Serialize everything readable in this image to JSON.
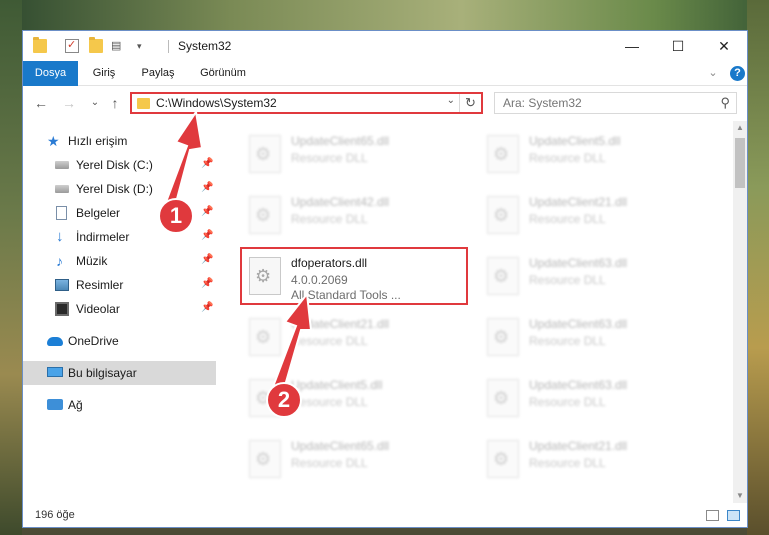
{
  "window": {
    "title": "System32",
    "minimize": "—",
    "maximize": "☐",
    "close": "✕"
  },
  "ribbon": {
    "tabs": [
      "Dosya",
      "Giriş",
      "Paylaş",
      "Görünüm"
    ],
    "active_tab": "Dosya",
    "expand": "⌄",
    "help": "?"
  },
  "nav": {
    "back": "←",
    "forward": "→",
    "recent": "⌄",
    "up": "↑",
    "address": "C:\\Windows\\System32",
    "address_dropdown": "⌄",
    "refresh": "↻",
    "search_placeholder": "Ara: System32"
  },
  "sidebar": {
    "items": [
      {
        "label": "Hızlı erişim",
        "icon": "star-icon",
        "pinned": false
      },
      {
        "label": "Yerel Disk (C:)",
        "icon": "drive-icon",
        "pinned": true
      },
      {
        "label": "Yerel Disk (D:)",
        "icon": "drive-icon",
        "pinned": true
      },
      {
        "label": "Belgeler",
        "icon": "documents-icon",
        "pinned": true
      },
      {
        "label": "İndirmeler",
        "icon": "download-icon",
        "pinned": true
      },
      {
        "label": "Müzik",
        "icon": "music-icon",
        "pinned": true
      },
      {
        "label": "Resimler",
        "icon": "pictures-icon",
        "pinned": true
      },
      {
        "label": "Videolar",
        "icon": "videos-icon",
        "pinned": true
      },
      {
        "label": "OneDrive",
        "icon": "cloud-icon",
        "pinned": false
      },
      {
        "label": "Bu bilgisayar",
        "icon": "computer-icon",
        "pinned": false,
        "selected": true
      },
      {
        "label": "Ağ",
        "icon": "network-icon",
        "pinned": false
      }
    ],
    "pin_glyph": "📌"
  },
  "files": [
    {
      "name": "UpdateClient65.dll",
      "desc": "Resource DLL",
      "blurred": true
    },
    {
      "name": "UpdateClient5.dll",
      "desc": "Resource DLL",
      "blurred": true
    },
    {
      "name": "UpdateClient42.dll",
      "desc": "Resource DLL",
      "blurred": true
    },
    {
      "name": "UpdateClient21.dll",
      "desc": "Resource DLL",
      "blurred": true
    },
    {
      "name": "dfoperators.dll",
      "desc": "4.0.0.2069",
      "desc2": "All Standard Tools ...",
      "blurred": false
    },
    {
      "name": "UpdateClient63.dll",
      "desc": "Resource DLL",
      "blurred": true
    },
    {
      "name": "UpdateClient21.dll",
      "desc": "Resource DLL",
      "blurred": true
    },
    {
      "name": "UpdateClient63.dll",
      "desc": "Resource DLL",
      "blurred": true
    },
    {
      "name": "UpdateClient5.dll",
      "desc": "Resource DLL",
      "blurred": true
    },
    {
      "name": "UpdateClient63.dll",
      "desc": "Resource DLL",
      "blurred": true
    },
    {
      "name": "UpdateClient65.dll",
      "desc": "Resource DLL",
      "blurred": true
    },
    {
      "name": "UpdateClient21.dll",
      "desc": "Resource DLL",
      "blurred": true
    }
  ],
  "status": {
    "count": "196 öğe"
  },
  "annotations": {
    "step1": "1",
    "step2": "2",
    "color": "#e0393d"
  }
}
